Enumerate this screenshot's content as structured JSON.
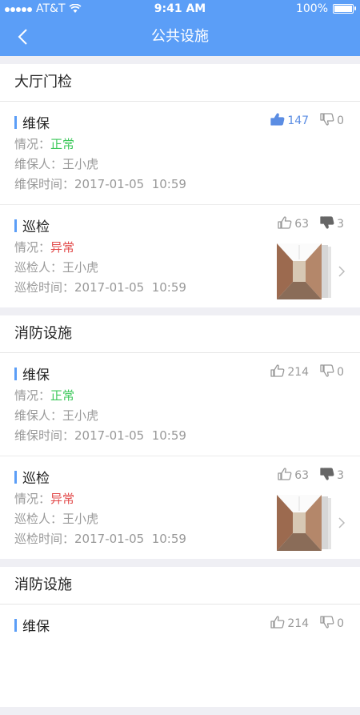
{
  "status_bar": {
    "carrier": "AT&T",
    "time": "9:41 AM",
    "battery": "100%"
  },
  "nav": {
    "title": "公共设施"
  },
  "sections": [
    {
      "title": "大厅门检",
      "records": [
        {
          "type": "维保",
          "likes": "147",
          "dislikes": "0",
          "liked": true,
          "disliked": false,
          "status_label": "情况：",
          "status": "正常",
          "person_label": "维保人：",
          "person": "王小虎",
          "time_label": "维保时间：",
          "time": "2017-01-05  10:59",
          "has_photo": false
        },
        {
          "type": "巡检",
          "likes": "63",
          "dislikes": "3",
          "liked": false,
          "disliked": true,
          "status_label": "情况：",
          "status": "异常",
          "person_label": "巡检人：",
          "person": "王小虎",
          "time_label": "巡检时间：",
          "time": "2017-01-05  10:59",
          "has_photo": true
        }
      ]
    },
    {
      "title": "消防设施",
      "records": [
        {
          "type": "维保",
          "likes": "214",
          "dislikes": "0",
          "liked": false,
          "disliked": false,
          "status_label": "情况：",
          "status": "正常",
          "person_label": "维保人：",
          "person": "王小虎",
          "time_label": "维保时间：",
          "time": "2017-01-05  10:59",
          "has_photo": false
        },
        {
          "type": "巡检",
          "likes": "63",
          "dislikes": "3",
          "liked": false,
          "disliked": true,
          "status_label": "情况：",
          "status": "异常",
          "person_label": "巡检人：",
          "person": "王小虎",
          "time_label": "巡检时间：",
          "time": "2017-01-05  10:59",
          "has_photo": true
        }
      ]
    },
    {
      "title": "消防设施",
      "records": [
        {
          "type": "维保",
          "likes": "214",
          "dislikes": "0",
          "liked": false,
          "disliked": false
        }
      ]
    }
  ],
  "colors": {
    "accent": "#5b9ef7",
    "ok": "#3cc85a",
    "bad": "#e24a4a",
    "liked": "#5b8de3"
  },
  "icons": {
    "back": "chevron-left-icon",
    "like": "thumbs-up-icon",
    "dislike": "thumbs-down-icon",
    "more": "chevron-right-icon"
  }
}
